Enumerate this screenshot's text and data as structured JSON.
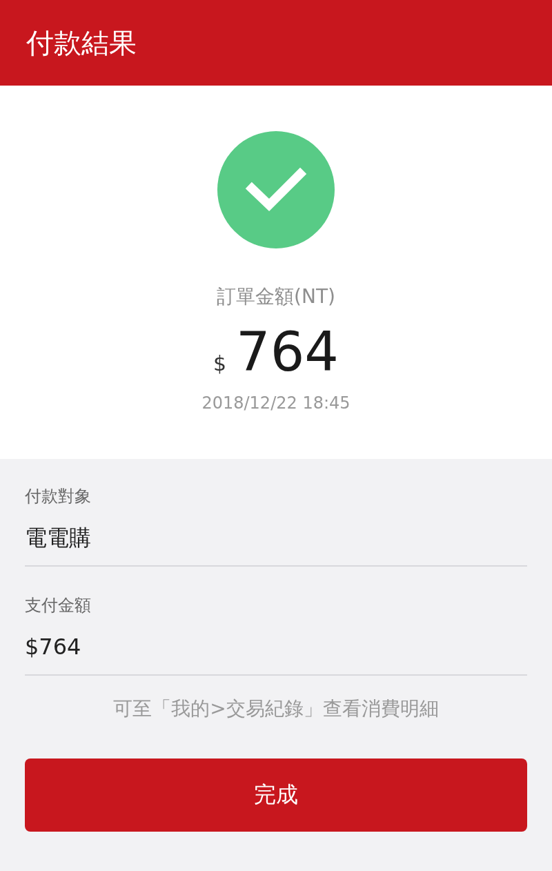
{
  "header": {
    "title": "付款結果"
  },
  "result": {
    "success": true,
    "amount_label": "訂單金額(NT)",
    "currency": "$",
    "amount": "764",
    "datetime": "2018/12/22 18:45"
  },
  "details": [
    {
      "label": "付款對象",
      "value": "電電購"
    },
    {
      "label": "支付金額",
      "value": "$764"
    }
  ],
  "note": "可至「我的>交易紀錄」查看消費明細",
  "done_button": {
    "label": "完成"
  }
}
